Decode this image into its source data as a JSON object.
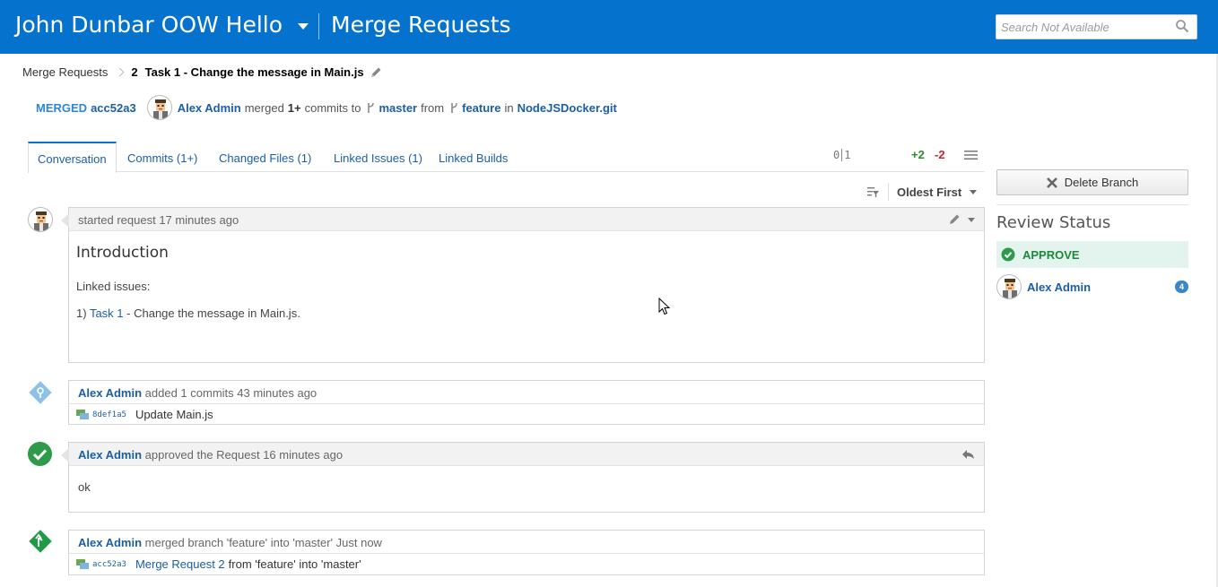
{
  "header": {
    "project": "John Dunbar OOW Hello",
    "page_title": "Merge Requests",
    "search_placeholder": "Search Not Available"
  },
  "breadcrumb": {
    "root": "Merge Requests",
    "number": "2",
    "title": "Task 1 - Change the message in Main.js"
  },
  "status": {
    "state": "MERGED",
    "hash": "acc52a3",
    "user": "Alex Admin",
    "verb": "merged",
    "count": "1+",
    "commits_to": "commits to",
    "target": "master",
    "from": "from",
    "source": "feature",
    "in": "in",
    "repo": "NodeJSDocker.git"
  },
  "tabs": [
    {
      "label": "Conversation"
    },
    {
      "label": "Commits (1+)"
    },
    {
      "label": "Changed Files (1)"
    },
    {
      "label": "Linked Issues (1)"
    },
    {
      "label": "Linked Builds"
    }
  ],
  "diffstat": {
    "left": "0",
    "right": "1",
    "added": "+2",
    "removed": "-2"
  },
  "sort": {
    "label": "Oldest First"
  },
  "timeline": {
    "request": {
      "header": "started request 17 minutes ago",
      "heading": "Introduction",
      "linked_label": "Linked issues:",
      "item_prefix": "1)",
      "item_link": "Task 1",
      "item_rest": "- Change the message in Main.js."
    },
    "commits_event": {
      "user": "Alex Admin",
      "text": "added 1 commits 43 minutes ago",
      "sha": "8def1a5",
      "message": "Update Main.js"
    },
    "approval": {
      "user": "Alex Admin",
      "text": "approved the Request 16 minutes ago",
      "comment": "ok"
    },
    "merge_event": {
      "user": "Alex Admin",
      "text": "merged branch 'feature' into 'master' Just now",
      "sha": "acc52a3",
      "link": "Merge Request 2",
      "rest": "from 'feature' into 'master'"
    }
  },
  "sidebar": {
    "delete_button": "Delete Branch",
    "review_title": "Review Status",
    "verdict": "APPROVE",
    "reviewer": "Alex Admin",
    "reviewer_count": "4"
  },
  "colors": {
    "brand": "#0572ce",
    "link": "#1a5ea8",
    "approve": "#1c8a3a",
    "added": "#2a8c2a",
    "removed": "#c8202a"
  }
}
